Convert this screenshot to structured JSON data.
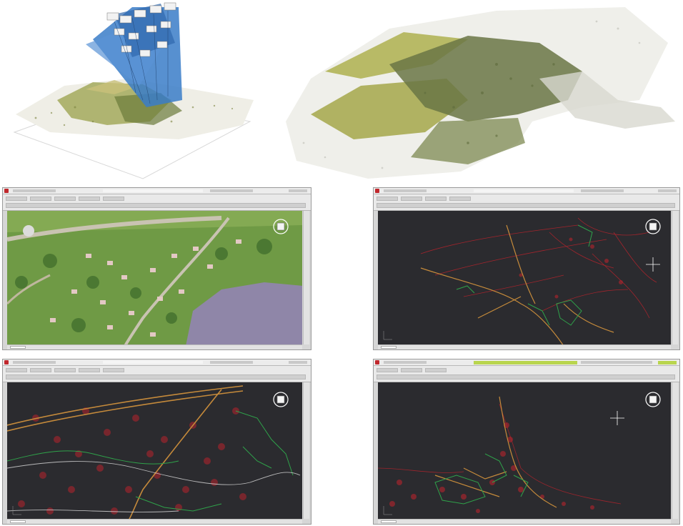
{
  "layout": {
    "top_panels": [
      "point-cloud-with-camera-views",
      "dense-point-cloud"
    ],
    "cad_windows": [
      "orthophoto-view",
      "vector-map-view-1",
      "vector-map-view-2",
      "vector-map-view-3"
    ]
  },
  "colors": {
    "page_background": "#ffffff",
    "cad_background": "#2b2b2f",
    "contour_red": "#b8232c",
    "vector_green": "#2fa24a",
    "road_orange": "#c58a3b",
    "camera_blue": "#3a7cc8",
    "terrain_green": "#8f9a3a",
    "water": "#8f86a8",
    "app_icon_red": "#c0282d",
    "ribbon_accent": "#b9d54e"
  },
  "icons": {
    "view_cube": "view-cube-icon",
    "crosshair": "crosshair-icon",
    "app": "app-icon",
    "ucs": "ucs-icon"
  }
}
